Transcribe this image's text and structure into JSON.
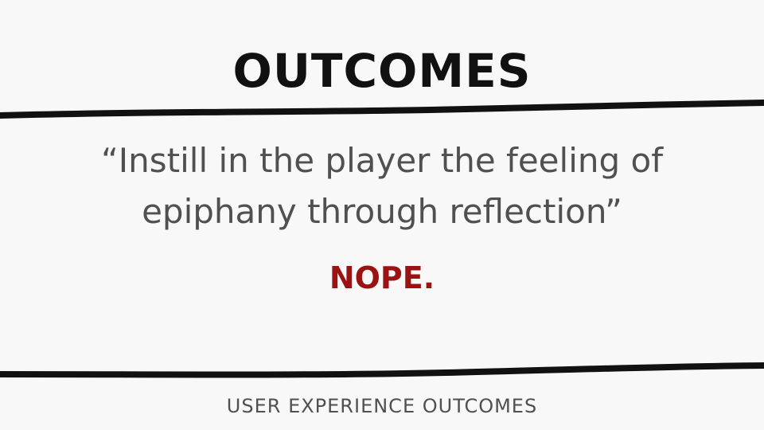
{
  "slide": {
    "title": "OUTCOMES",
    "quote": "“Instill in the player the feeling of epiphany through reflection”",
    "verdict": "NOPE.",
    "footer": "USER EXPERIENCE OUTCOMES"
  },
  "colors": {
    "background": "#f8f8f8",
    "title": "#111111",
    "body_text": "#505050",
    "verdict": "#9b1212",
    "rules": "#111111"
  }
}
